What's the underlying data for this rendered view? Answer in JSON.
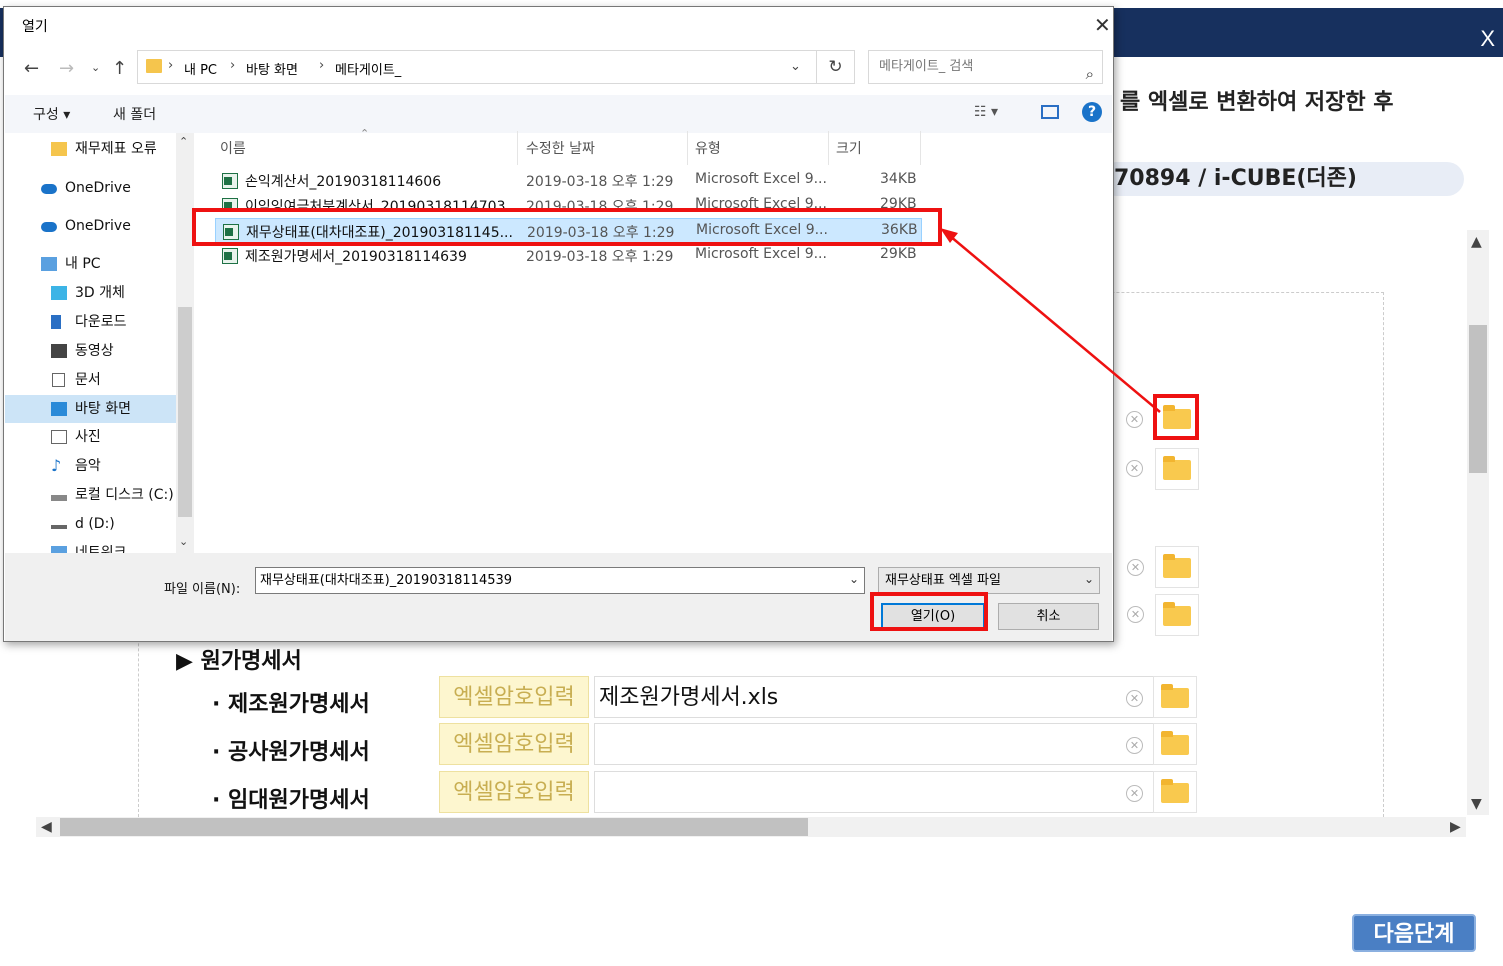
{
  "background": {
    "close_label": "X",
    "instruction_text": "를 엑셀로 변환하여 저장한 후",
    "company_text": "70894 / i-CUBE(더존)",
    "next_button": "다음단계",
    "sections": [
      {
        "title": "▶ 원가명세서",
        "rows": [
          {
            "label": "· 제조원가명세서",
            "password_button": "엑셀암호입력",
            "file_value": "제조원가명세서.xls"
          },
          {
            "label": "· 공사원가명세서",
            "password_button": "엑셀암호입력",
            "file_value": ""
          },
          {
            "label": "· 임대원가명세서",
            "password_button": "엑셀암호입력",
            "file_value": ""
          }
        ]
      }
    ]
  },
  "dialog": {
    "title": "열기",
    "close_label": "X",
    "breadcrumb": [
      "내 PC",
      "바탕 화면",
      "메타게이트_"
    ],
    "search_placeholder": "메타게이트_ 검색",
    "toolbar": {
      "organize": "구성 ▾",
      "new_folder": "새 폴더"
    },
    "nav_items": [
      {
        "label": "재무제표 오류",
        "icon": "folder-icon"
      },
      {
        "label": "OneDrive",
        "icon": "cloud-icon"
      },
      {
        "label": "OneDrive",
        "icon": "cloud-icon"
      },
      {
        "label": "내 PC",
        "icon": "computer-icon"
      },
      {
        "label": "3D 개체",
        "icon": "cube-icon"
      },
      {
        "label": "다운로드",
        "icon": "download-icon"
      },
      {
        "label": "동영상",
        "icon": "video-icon"
      },
      {
        "label": "문서",
        "icon": "document-icon"
      },
      {
        "label": "바탕 화면",
        "icon": "desktop-icon",
        "selected": true
      },
      {
        "label": "사진",
        "icon": "picture-icon"
      },
      {
        "label": "음악",
        "icon": "music-icon"
      },
      {
        "label": "로컬 디스크 (C:)",
        "icon": "drive-icon"
      },
      {
        "label": "d (D:)",
        "icon": "drive-icon"
      },
      {
        "label": "네트워크",
        "icon": "network-icon"
      }
    ],
    "columns": {
      "name": "이름",
      "date": "수정한 날짜",
      "type": "유형",
      "size": "크기"
    },
    "files": [
      {
        "name": "손익계산서_20190318114606",
        "date": "2019-03-18 오후 1:29",
        "type": "Microsoft Excel 9...",
        "size": "34KB"
      },
      {
        "name": "이익잉여금처분계산서_20190318114703",
        "date": "2019-03-18 오후 1:29",
        "type": "Microsoft Excel 9...",
        "size": "29KB"
      },
      {
        "name": "재무상태표(대차대조표)_201903181145...",
        "date": "2019-03-18 오후 1:29",
        "type": "Microsoft Excel 9...",
        "size": "36KB",
        "selected": true
      },
      {
        "name": "제조원가명세서_20190318114639",
        "date": "2019-03-18 오후 1:29",
        "type": "Microsoft Excel 9...",
        "size": "29KB"
      }
    ],
    "filename_label": "파일 이름(N):",
    "filename_value": "재무상태표(대차대조표)_20190318114539",
    "filetype_value": "재무상태표 엑셀 파일",
    "open_button": "열기(O)",
    "cancel_button": "취소"
  },
  "colors": {
    "titlebar": "#17305e",
    "annotation_red": "#ee1111",
    "next_button": "#4a7fc4",
    "password_button_bg": "#fdf6cf",
    "selection": "#cce8ff"
  }
}
